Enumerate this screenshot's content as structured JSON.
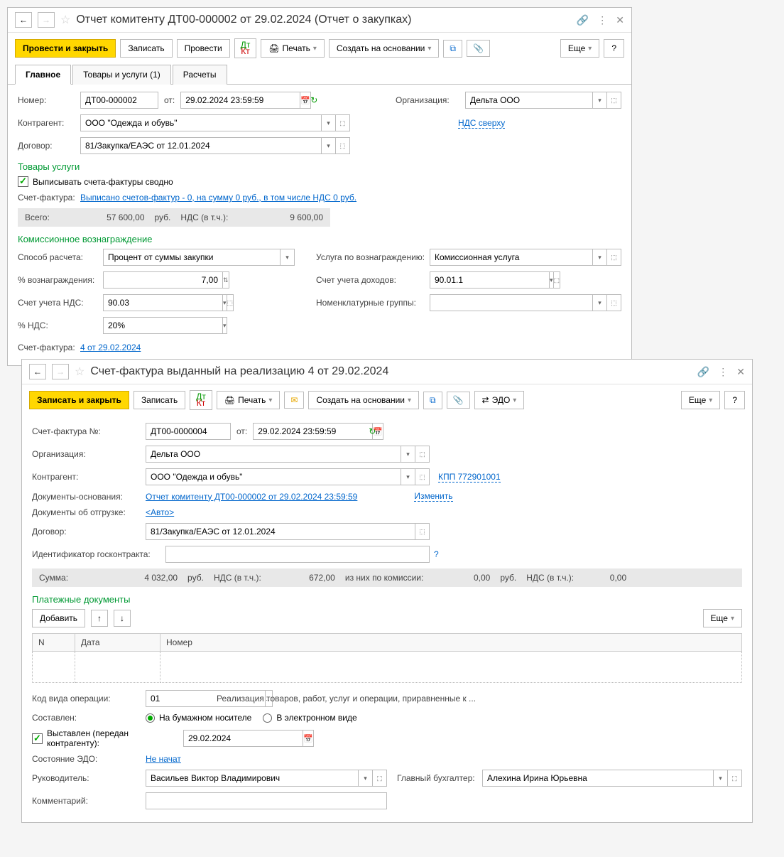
{
  "w1": {
    "title": "Отчет комитенту ДТ00-000002 от 29.02.2024 (Отчет о закупках)",
    "toolbar": {
      "post_close": "Провести и закрыть",
      "save": "Записать",
      "post": "Провести",
      "print": "Печать",
      "create_based": "Создать на основании",
      "more": "Еще",
      "help": "?"
    },
    "tabs": {
      "main": "Главное",
      "goods": "Товары и услуги (1)",
      "calc": "Расчеты"
    },
    "labels": {
      "number": "Номер:",
      "from": "от:",
      "org": "Организация:",
      "contragent": "Контрагент:",
      "contract": "Договор:",
      "goods_services": "Товары услуги",
      "write_sf_summary": "Выписывать счета-фактуры сводно",
      "sf": "Счет-фактура:",
      "total": "Всего:",
      "rub": "руб.",
      "nds_inc": "НДС (в т.ч.):",
      "commission_title": "Комиссионное вознаграждение",
      "calc_method": "Способ расчета:",
      "reward_pct": "% вознаграждения:",
      "nds_account": "Счет учета НДС:",
      "nds_pct": "% НДС:",
      "service_reward": "Услуга по вознаграждению:",
      "income_account": "Счет учета доходов:",
      "nom_groups": "Номенклатурные группы:",
      "sf2": "Счет-фактура:"
    },
    "values": {
      "number": "ДТ00-000002",
      "date": "29.02.2024 23:59:59",
      "org": "Дельта ООО",
      "contragent": "ООО \"Одежда и обувь\"",
      "nds_top": "НДС сверху",
      "contract": "81/Закупка/ЕАЭС от 12.01.2024",
      "sf_text": "Выписано счетов-фактур - 0, на сумму 0 руб., в том числе НДС 0 руб.",
      "total": "57 600,00",
      "nds_total": "9 600,00",
      "calc_method": "Процент от суммы закупки",
      "reward_pct": "7,00",
      "nds_account": "90.03",
      "nds_pct": "20%",
      "service_reward": "Комиссионная услуга",
      "income_account": "90.01.1",
      "nom_groups": "",
      "sf_link": "4 от 29.02.2024"
    }
  },
  "w2": {
    "title": "Счет-фактура выданный на реализацию 4 от 29.02.2024",
    "toolbar": {
      "save_close": "Записать и закрыть",
      "save": "Записать",
      "print": "Печать",
      "create_based": "Создать на основании",
      "edo": "ЭДО",
      "more": "Еще",
      "help": "?"
    },
    "labels": {
      "sf_num": "Счет-фактура №:",
      "from": "от:",
      "org": "Организация:",
      "contragent": "Контрагент:",
      "basis_docs": "Документы-основания:",
      "change": "Изменить",
      "ship_docs": "Документы об отгрузке:",
      "contract": "Договор:",
      "goskontrakt_id": "Идентификатор госконтракта:",
      "sum": "Сумма:",
      "rub": "руб.",
      "nds_inc": "НДС (в т.ч.):",
      "comm_from": "из них по комиссии:",
      "payment_title": "Платежные документы",
      "add": "Добавить",
      "more": "Еще",
      "col_n": "N",
      "col_date": "Дата",
      "col_num": "Номер",
      "op_code": "Код вида операции:",
      "op_desc": "Реализация товаров, работ, услуг и операции, приравненные к ...",
      "composed": "Составлен:",
      "paper": "На бумажном носителе",
      "electronic": "В электронном виде",
      "issued": "Выставлен (передан контрагенту):",
      "edo_state": "Состояние ЭДО:",
      "head": "Руководитель:",
      "chief_acc": "Главный бухгалтер:",
      "comment": "Комментарий:"
    },
    "values": {
      "sf_num": "ДТ00-0000004",
      "date": "29.02.2024 23:59:59",
      "org": "Дельта ООО",
      "contragent": "ООО \"Одежда и обувь\"",
      "kpp": "КПП 772901001",
      "basis_doc": "Отчет комитенту ДТ00-000002 от 29.02.2024 23:59:59",
      "auto": "<Авто>",
      "contract": "81/Закупка/ЕАЭС от 12.01.2024",
      "goskontrakt": "",
      "sum": "4 032,00",
      "nds": "672,00",
      "comm_sum": "0,00",
      "comm_nds": "0,00",
      "op_code": "01",
      "issued_date": "29.02.2024",
      "edo_state": "Не начат",
      "head": "Васильев Виктор Владимирович",
      "chief_acc": "Алехина Ирина Юрьевна",
      "comment": ""
    }
  }
}
